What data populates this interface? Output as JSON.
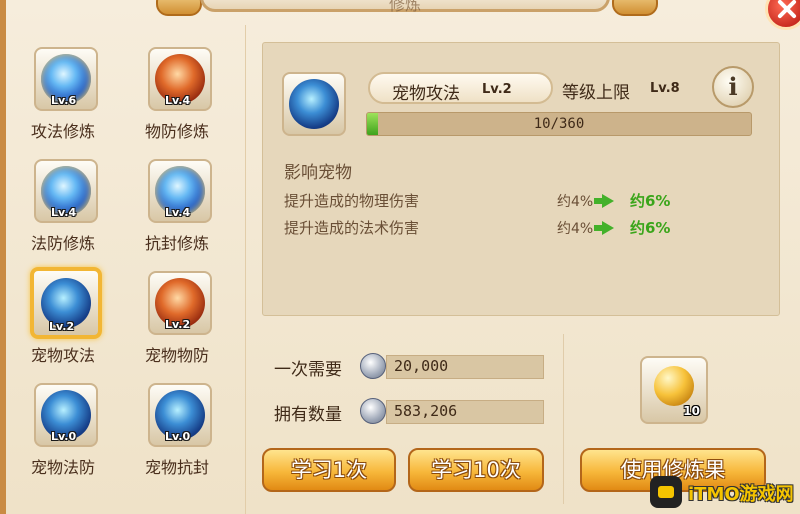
{
  "window": {
    "title": "修炼"
  },
  "skills": [
    {
      "name": "攻法修炼",
      "level": "Lv.6",
      "icon": "blue-rune-orb-icon"
    },
    {
      "name": "物防修炼",
      "level": "Lv.4",
      "icon": "red-shield-orb-icon"
    },
    {
      "name": "法防修炼",
      "level": "Lv.4",
      "icon": "blue-shield-orb-icon"
    },
    {
      "name": "抗封修炼",
      "level": "Lv.4",
      "icon": "blue-seal-orb-icon"
    },
    {
      "name": "宠物攻法",
      "level": "Lv.2",
      "icon": "pet-attack-orb-icon",
      "selected": true
    },
    {
      "name": "宠物物防",
      "level": "Lv.2",
      "icon": "pet-defense-orb-icon"
    },
    {
      "name": "宠物法防",
      "level": "Lv.0",
      "icon": "pet-magic-defense-orb-icon"
    },
    {
      "name": "宠物抗封",
      "level": "Lv.0",
      "icon": "pet-seal-resist-orb-icon"
    }
  ],
  "detail": {
    "name": "宠物攻法",
    "level": "Lv.2",
    "cap_label": "等级上限",
    "cap_level": "Lv.8",
    "info_symbol": "i",
    "progress_text": "10/360",
    "progress_fraction": 0.028,
    "affect_title": "影响宠物",
    "effects": [
      {
        "label": "提升造成的物理伤害",
        "current": "约4%",
        "next": "约6%"
      },
      {
        "label": "提升造成的法术伤害",
        "current": "约4%",
        "next": "约6%"
      }
    ]
  },
  "cost": {
    "once_label": "一次需要",
    "once_value": "20,000",
    "own_label": "拥有数量",
    "own_value": "583,206",
    "currency_icon": "silver-coin-icon"
  },
  "buttons": {
    "learn_once": "学习1次",
    "learn_ten": "学习10次",
    "use_fruit": "使用修炼果"
  },
  "item": {
    "quantity": "10",
    "icon": "golden-fruit-icon"
  },
  "watermark": {
    "text": "iTMO游戏网"
  },
  "colors": {
    "accent": "#f7b73a",
    "progress": "#3ea31c",
    "positive": "#3aa51a"
  }
}
